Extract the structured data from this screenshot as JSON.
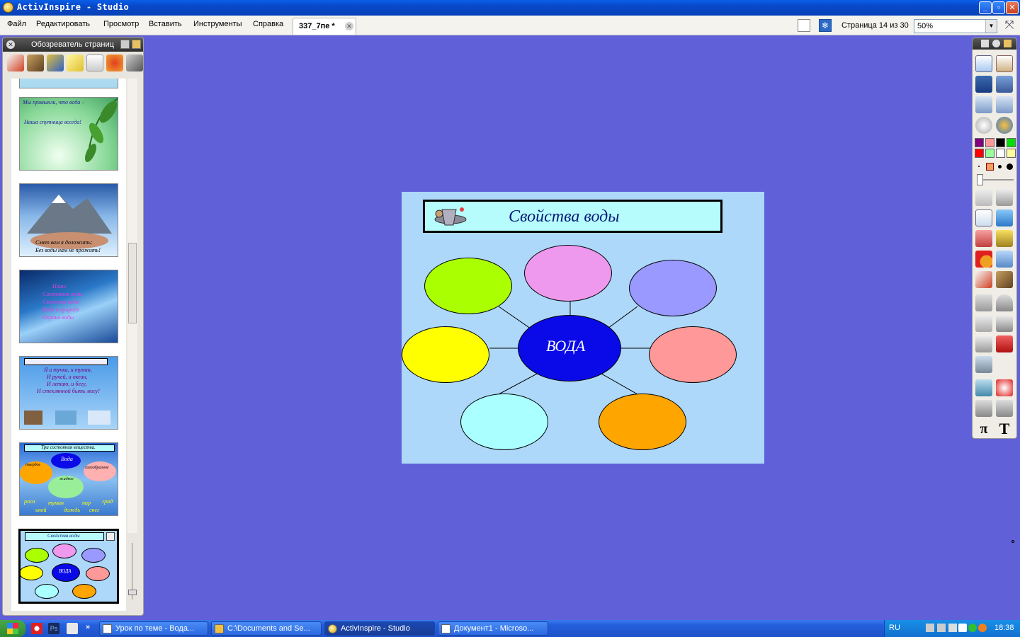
{
  "window": {
    "title": "ActivInspire - Studio"
  },
  "menu": [
    "Файл",
    "Редактировать",
    "Просмотр",
    "Вставить",
    "Инструменты",
    "Справка"
  ],
  "document_tab": {
    "label": "337_7пе *"
  },
  "page_counter": "Страница 14 из 30",
  "zoom": "50%",
  "page_browser": {
    "title": "Обозреватель страниц",
    "thumbs": [
      {
        "lines": [
          "Мы привыкли, что вода –",
          "Наша спутница всегда!"
        ]
      },
      {
        "lines": [
          "Смею вам я доложить:",
          "Без воды нам не прожить!"
        ]
      },
      {
        "lines": [
          "План:",
          "Состояния воды",
          "Свойства воды",
          "Вода в природе",
          "Охрана воды"
        ]
      },
      {
        "lines": [
          "Я и тучка, и туман,",
          "И ручей, и океан,",
          "И летаю, и бегу,",
          "И стеклянной быть могу!"
        ]
      },
      {
        "title": "Три состояния вещества.",
        "center": "Вода",
        "labels": [
          "твердое",
          "газообразное",
          "жидкое",
          "роса",
          "туман",
          "пар",
          "град",
          "иней",
          "дождь",
          "снег"
        ]
      },
      {
        "title": "Свойства воды",
        "center": "ВОДА"
      }
    ]
  },
  "slide": {
    "title": "Свойства воды",
    "center_label": "ВОДА",
    "colors": {
      "background": "#add8fa",
      "center": "#0a0ae8",
      "top_left": "#aaff00",
      "top": "#ee99ee",
      "top_right": "#9999ff",
      "left": "#ffff00",
      "right": "#ff9999",
      "bottom_left": "#aaffff",
      "bottom_right": "#ffa500"
    }
  },
  "toolbox": {
    "palette": [
      "#800080",
      "#ff9999",
      "#000000",
      "#00e000",
      "#ff0000",
      "#99ff99",
      "#ffffff",
      "#ffffa0"
    ]
  },
  "taskbar": {
    "tasks": [
      "Урок по теме - Вода...",
      "C:\\Documents and Se...",
      "ActivInspire - Studio",
      "Документ1 - Microso..."
    ],
    "lang": "RU",
    "clock": "18:38"
  }
}
